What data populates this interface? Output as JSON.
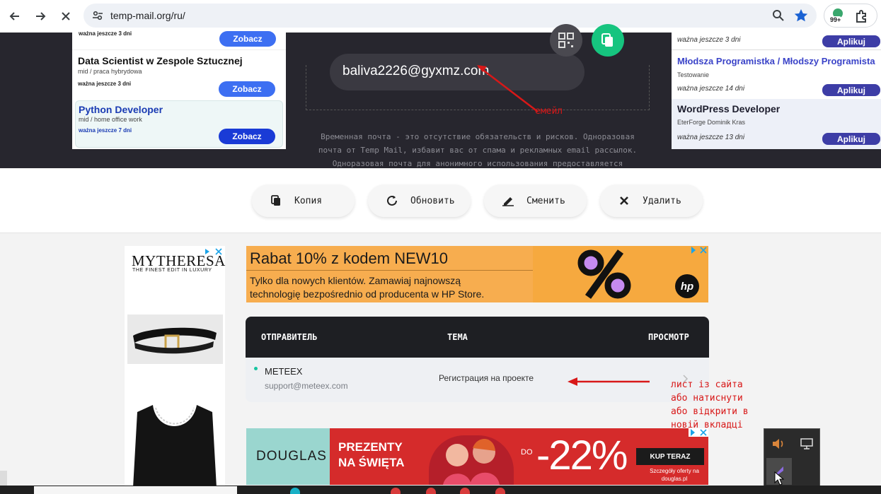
{
  "browser": {
    "url": "temp-mail.org/ru/",
    "extension_badge": "99+"
  },
  "jobs_left": {
    "top_valid": "ważna jeszcze 3 dni",
    "top_button": "Zobacz",
    "items": [
      {
        "title": "Data Scientist w Zespole Sztucznej",
        "sub": "mid / praca hybrydowa",
        "valid": "ważna jeszcze 3 dni",
        "button": "Zobacz"
      },
      {
        "title": "Python Developer",
        "sub": "mid / home office work",
        "valid": "ważna jeszcze 7 dni",
        "button": "Zobacz"
      }
    ]
  },
  "jobs_right": {
    "top_valid": "ważna jeszcze 3 dni",
    "top_button": "Aplikuj",
    "items": [
      {
        "title": "Młodsza Programistka / Młodszy Programista",
        "sub": "Testowanie",
        "valid": "ważna jeszcze 14 dni",
        "button": "Aplikuj"
      },
      {
        "title": "WordPress Developer",
        "sub": "EterForge Dominik Kras",
        "valid": "ważna jeszcze 13 dni",
        "button": "Aplikuj"
      }
    ]
  },
  "hero": {
    "email": "baliva2226@gyxmz.com",
    "description": "Временная почта - это отсутствие обязательств и рисков. Одноразовая почта от Temp Mail, избавит вас от спама и рекламных email рассылок. Одноразовая почта для анонимного использования предоставляется бесплатно.",
    "annotation": "емейл"
  },
  "actions": {
    "copy": "Копия",
    "refresh": "Обновить",
    "change": "Сменить",
    "delete": "Удалить"
  },
  "ads": {
    "mytheresa_brand": "MYTHERESA",
    "mytheresa_tagline": "THE FINEST EDIT IN LUXURY",
    "hp_headline": "Rabat 10% z kodem NEW10",
    "hp_body": "Tylko dla nowych klientów. Zamawiaj najnowszą technologię bezpośrednio od producenta w HP Store.",
    "hp_logo": "hp",
    "douglas_brand": "DOUGLAS",
    "douglas_headline": "PREZENTY NA ŚWIĘTA",
    "douglas_do": "DO",
    "douglas_discount": "-22%",
    "douglas_cta": "KUP TERAZ",
    "douglas_small": "Szczegóły oferty na douglas.pl"
  },
  "inbox": {
    "headers": {
      "sender": "ОТПРАВИТЕЛЬ",
      "subject": "ТЕМА",
      "view": "ПРОСМОТР"
    },
    "message": {
      "sender_name": "METEEX",
      "sender_email": "support@meteex.com",
      "subject": "Регистрация на проекте"
    }
  },
  "note_letter": [
    "лист із сайта",
    "або натиснути",
    "або відкрити в",
    "новій вкладці"
  ],
  "colors": {
    "accent_blue": "#3d6ff2",
    "hero_bg": "#27262e",
    "annotation_red": "#d81818",
    "green_button": "#16c47f"
  }
}
